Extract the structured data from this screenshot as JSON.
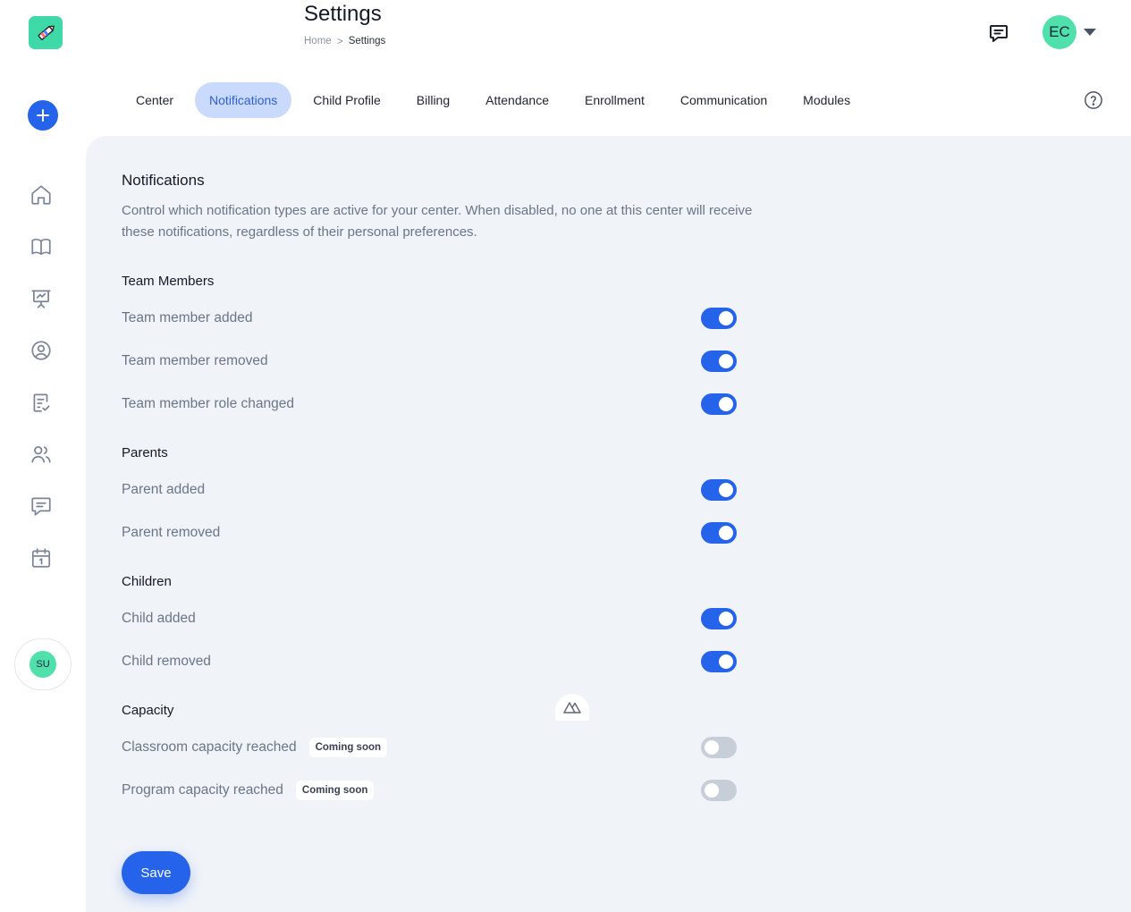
{
  "header": {
    "title": "Settings",
    "breadcrumb": {
      "home": "Home",
      "separator": ">",
      "current": "Settings"
    },
    "user_initials": "EC"
  },
  "sidebar": {
    "user_initials": "SU",
    "items": [
      "home-icon",
      "book-icon",
      "presentation-chart-icon",
      "user-circle-icon",
      "clipboard-check-icon",
      "users-icon",
      "chat-icon",
      "calendar-icon"
    ]
  },
  "tabs": [
    {
      "label": "Center",
      "active": false
    },
    {
      "label": "Notifications",
      "active": true
    },
    {
      "label": "Child Profile",
      "active": false
    },
    {
      "label": "Billing",
      "active": false
    },
    {
      "label": "Attendance",
      "active": false
    },
    {
      "label": "Enrollment",
      "active": false
    },
    {
      "label": "Communication",
      "active": false
    },
    {
      "label": "Modules",
      "active": false
    }
  ],
  "main": {
    "title": "Notifications",
    "description": "Control which notification types are active for your center. When disabled, no one at this center will receive these notifications, regardless of their personal preferences.",
    "groups": [
      {
        "title": "Team Members",
        "items": [
          {
            "label": "Team member added",
            "enabled": true
          },
          {
            "label": "Team member removed",
            "enabled": true
          },
          {
            "label": "Team member role changed",
            "enabled": true
          }
        ]
      },
      {
        "title": "Parents",
        "items": [
          {
            "label": "Parent added",
            "enabled": true
          },
          {
            "label": "Parent removed",
            "enabled": true
          }
        ]
      },
      {
        "title": "Children",
        "items": [
          {
            "label": "Child added",
            "enabled": true
          },
          {
            "label": "Child removed",
            "enabled": true
          }
        ]
      },
      {
        "title": "Capacity",
        "items": [
          {
            "label": "Classroom capacity reached",
            "enabled": false,
            "badge": "Coming soon"
          },
          {
            "label": "Program capacity reached",
            "enabled": false,
            "badge": "Coming soon"
          }
        ]
      }
    ],
    "save_label": "Save"
  },
  "colors": {
    "accent": "#2563eb",
    "active_tab_bg": "#c9dafc",
    "avatar": "#4fe0ab",
    "panel_bg": "#f0f3f8",
    "toggle_off": "#c8ced8"
  }
}
